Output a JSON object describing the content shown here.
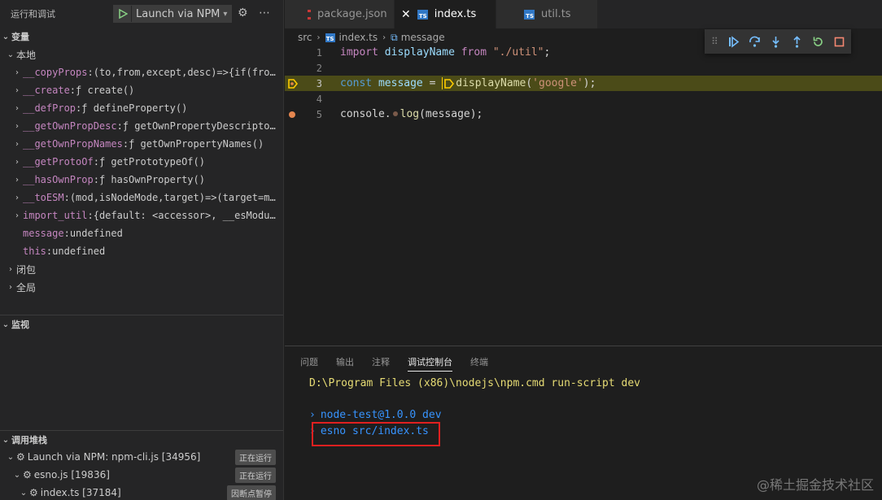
{
  "sidebar": {
    "header_title": "运行和调试",
    "launch_config": "Launch via NPM",
    "variables_title": "变量",
    "local_title": "本地",
    "variables": [
      {
        "name": "__copyProps",
        "value": "(to,from,except,desc)=>{if(fro…",
        "expandable": true
      },
      {
        "name": "__create",
        "value": "ƒ create()",
        "expandable": true
      },
      {
        "name": "__defProp",
        "value": "ƒ defineProperty()",
        "expandable": true
      },
      {
        "name": "__getOwnPropDesc",
        "value": "ƒ getOwnPropertyDescripto…",
        "expandable": true
      },
      {
        "name": "__getOwnPropNames",
        "value": "ƒ getOwnPropertyNames()",
        "expandable": true
      },
      {
        "name": "__getProtoOf",
        "value": "ƒ getPrototypeOf()",
        "expandable": true
      },
      {
        "name": "__hasOwnProp",
        "value": "ƒ hasOwnProperty()",
        "expandable": true
      },
      {
        "name": "__toESM",
        "value": "(mod,isNodeMode,target)=>(target=m…",
        "expandable": true
      },
      {
        "name": "import_util",
        "value": "{default: <accessor>, __esModu…",
        "expandable": true
      },
      {
        "name": "message",
        "value": "undefined",
        "expandable": false
      },
      {
        "name": "this",
        "value": "undefined",
        "expandable": false
      }
    ],
    "closure_title": "闭包",
    "global_title": "全局",
    "watch_title": "监视",
    "callstack_title": "调用堆栈",
    "callstack": [
      {
        "label": "Launch via NPM: npm-cli.js [34956]",
        "badge": "正在运行"
      },
      {
        "label": "esno.js [19836]",
        "badge": "正在运行"
      },
      {
        "label": "index.ts [37184]",
        "badge": "因断点暂停"
      }
    ]
  },
  "tabs": [
    {
      "label": "package.json",
      "active": false
    },
    {
      "label": "index.ts",
      "active": true
    },
    {
      "label": "util.ts",
      "active": false
    }
  ],
  "breadcrumb": {
    "folder": "src",
    "file": "index.ts",
    "symbol": "message"
  },
  "code": {
    "line_numbers": [
      "1",
      "2",
      "3",
      "4",
      "5"
    ],
    "line1": {
      "kw": "import",
      "name": "displayName",
      "from": "from",
      "str": "\"./util\"",
      "end": ";"
    },
    "line3": {
      "kw": "const",
      "name": "message",
      "eq": "=",
      "fn": "displayName",
      "open": "(",
      "str": "'google'",
      "close": ");"
    },
    "line5": {
      "obj": "console.",
      "fn": "log",
      "args": "(message);"
    }
  },
  "panel": {
    "tabs": [
      "问题",
      "输出",
      "注释",
      "调试控制台",
      "终端"
    ],
    "active_tab": "调试控制台",
    "console": {
      "line1": "D:\\Program Files (x86)\\nodejs\\npm.cmd run-script dev",
      "line2": "node-test@1.0.0 dev",
      "line3": "esno src/index.ts"
    }
  },
  "watermark": "@稀土掘金技术社区",
  "colors": {
    "highlight_line": "#4b4b18",
    "breakpoint": "#e5864f",
    "accent_blue": "#3794ff",
    "annotation_red": "#e02020"
  }
}
